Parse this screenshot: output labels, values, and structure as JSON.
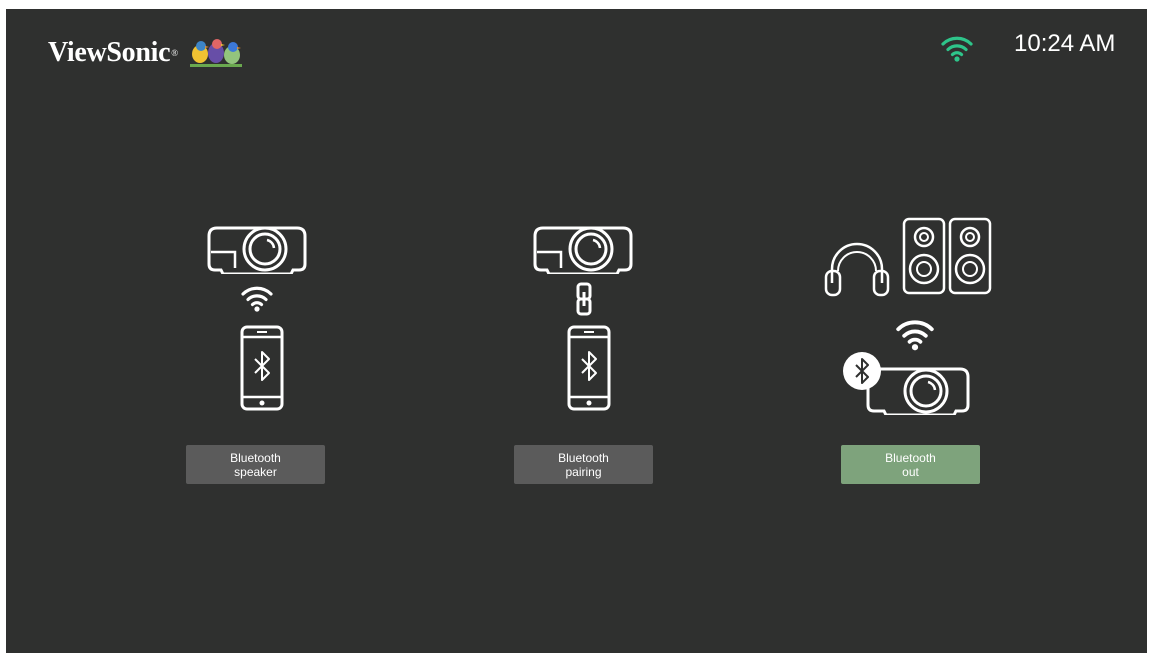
{
  "header": {
    "brand": "ViewSonic",
    "brand_mark": "®",
    "logo_icon": "viewsonic-birds-logo",
    "wifi_icon": "wifi-icon",
    "wifi_color": "#2ec48a",
    "time": "10:24 AM"
  },
  "options": [
    {
      "line1": "Bluetooth",
      "line2": "speaker",
      "selected": false,
      "icons": [
        "projector-icon",
        "wifi-icon",
        "bluetooth-phone-icon"
      ]
    },
    {
      "line1": "Bluetooth",
      "line2": "pairing",
      "selected": false,
      "icons": [
        "projector-icon",
        "link-icon",
        "bluetooth-phone-icon"
      ]
    },
    {
      "line1": "Bluetooth",
      "line2": "out",
      "selected": true,
      "icons": [
        "headphones-icon",
        "speakers-icon",
        "wifi-icon",
        "bluetooth-projector-icon"
      ]
    }
  ],
  "colors": {
    "background": "#2f302f",
    "button": "#5b5b5b",
    "button_selected": "#7ea37c",
    "icon": "#ffffff"
  }
}
